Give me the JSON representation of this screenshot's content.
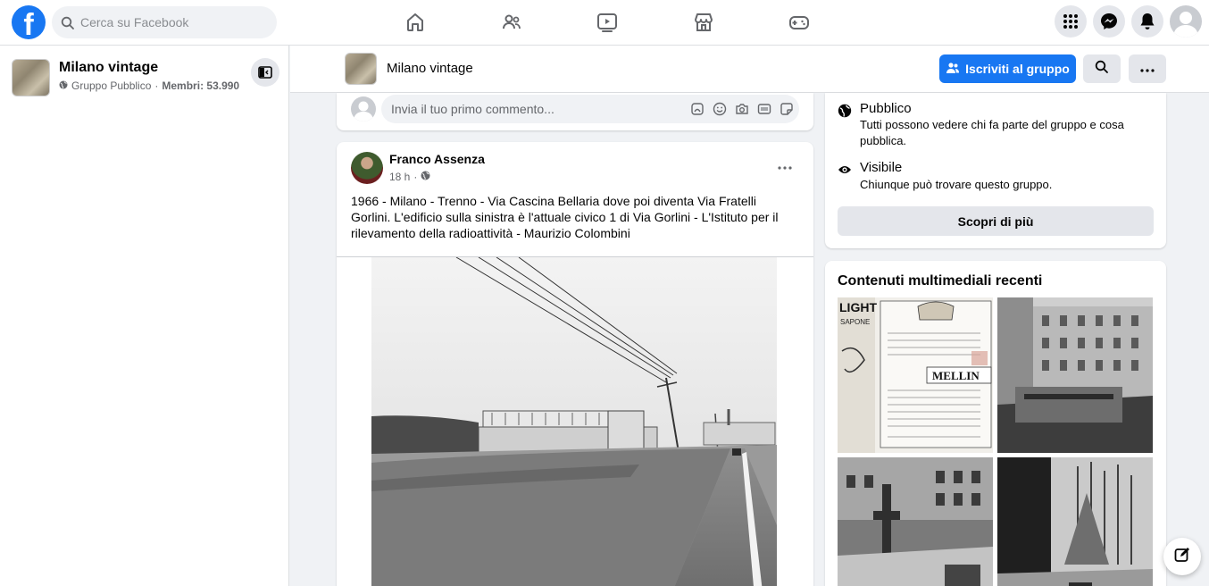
{
  "topbar": {
    "logo_letter": "f",
    "search_placeholder": "Cerca su Facebook",
    "nav_icons": [
      "home-icon",
      "friends-icon",
      "watch-icon",
      "marketplace-icon",
      "gaming-icon"
    ],
    "right_icons": [
      "menu-grid-icon",
      "messenger-icon",
      "notifications-icon",
      "account-avatar"
    ]
  },
  "sidebar": {
    "group_name": "Milano vintage",
    "privacy": "Gruppo Pubblico",
    "separator": "·",
    "members_label": "Membri: 53.990"
  },
  "group_header": {
    "title": "Milano vintage",
    "join_label": "Iscriviti al gruppo"
  },
  "comment_box": {
    "placeholder": "Invia il tuo primo commento..."
  },
  "post": {
    "author": "Franco Assenza",
    "time": "18 h",
    "separator": "·",
    "text": "1966 - Milano - Trenno - Via Cascina Bellaria dove poi diventa Via Fratelli Gorlini. L'edificio sulla sinistra è l'attuale civico 1 di Via Gorlini - L'Istituto per il rilevamento della radioattività - Maurizio Colombini"
  },
  "about": {
    "items": [
      {
        "title": "Pubblico",
        "description": "Tutti possono vedere chi fa parte del gruppo e cosa pubblica.",
        "icon": "globe-icon"
      },
      {
        "title": "Visibile",
        "description": "Chiunque può trovare questo gruppo.",
        "icon": "eye-icon"
      }
    ],
    "button_label": "Scopri di più"
  },
  "media": {
    "title": "Contenuti multimediali recenti",
    "thumb_text": [
      "LIGHT",
      "SAPONE",
      "MELLIN"
    ]
  },
  "colors": {
    "accent": "#1877f2",
    "background": "#f0f2f5",
    "secondary_text": "#65676b"
  }
}
